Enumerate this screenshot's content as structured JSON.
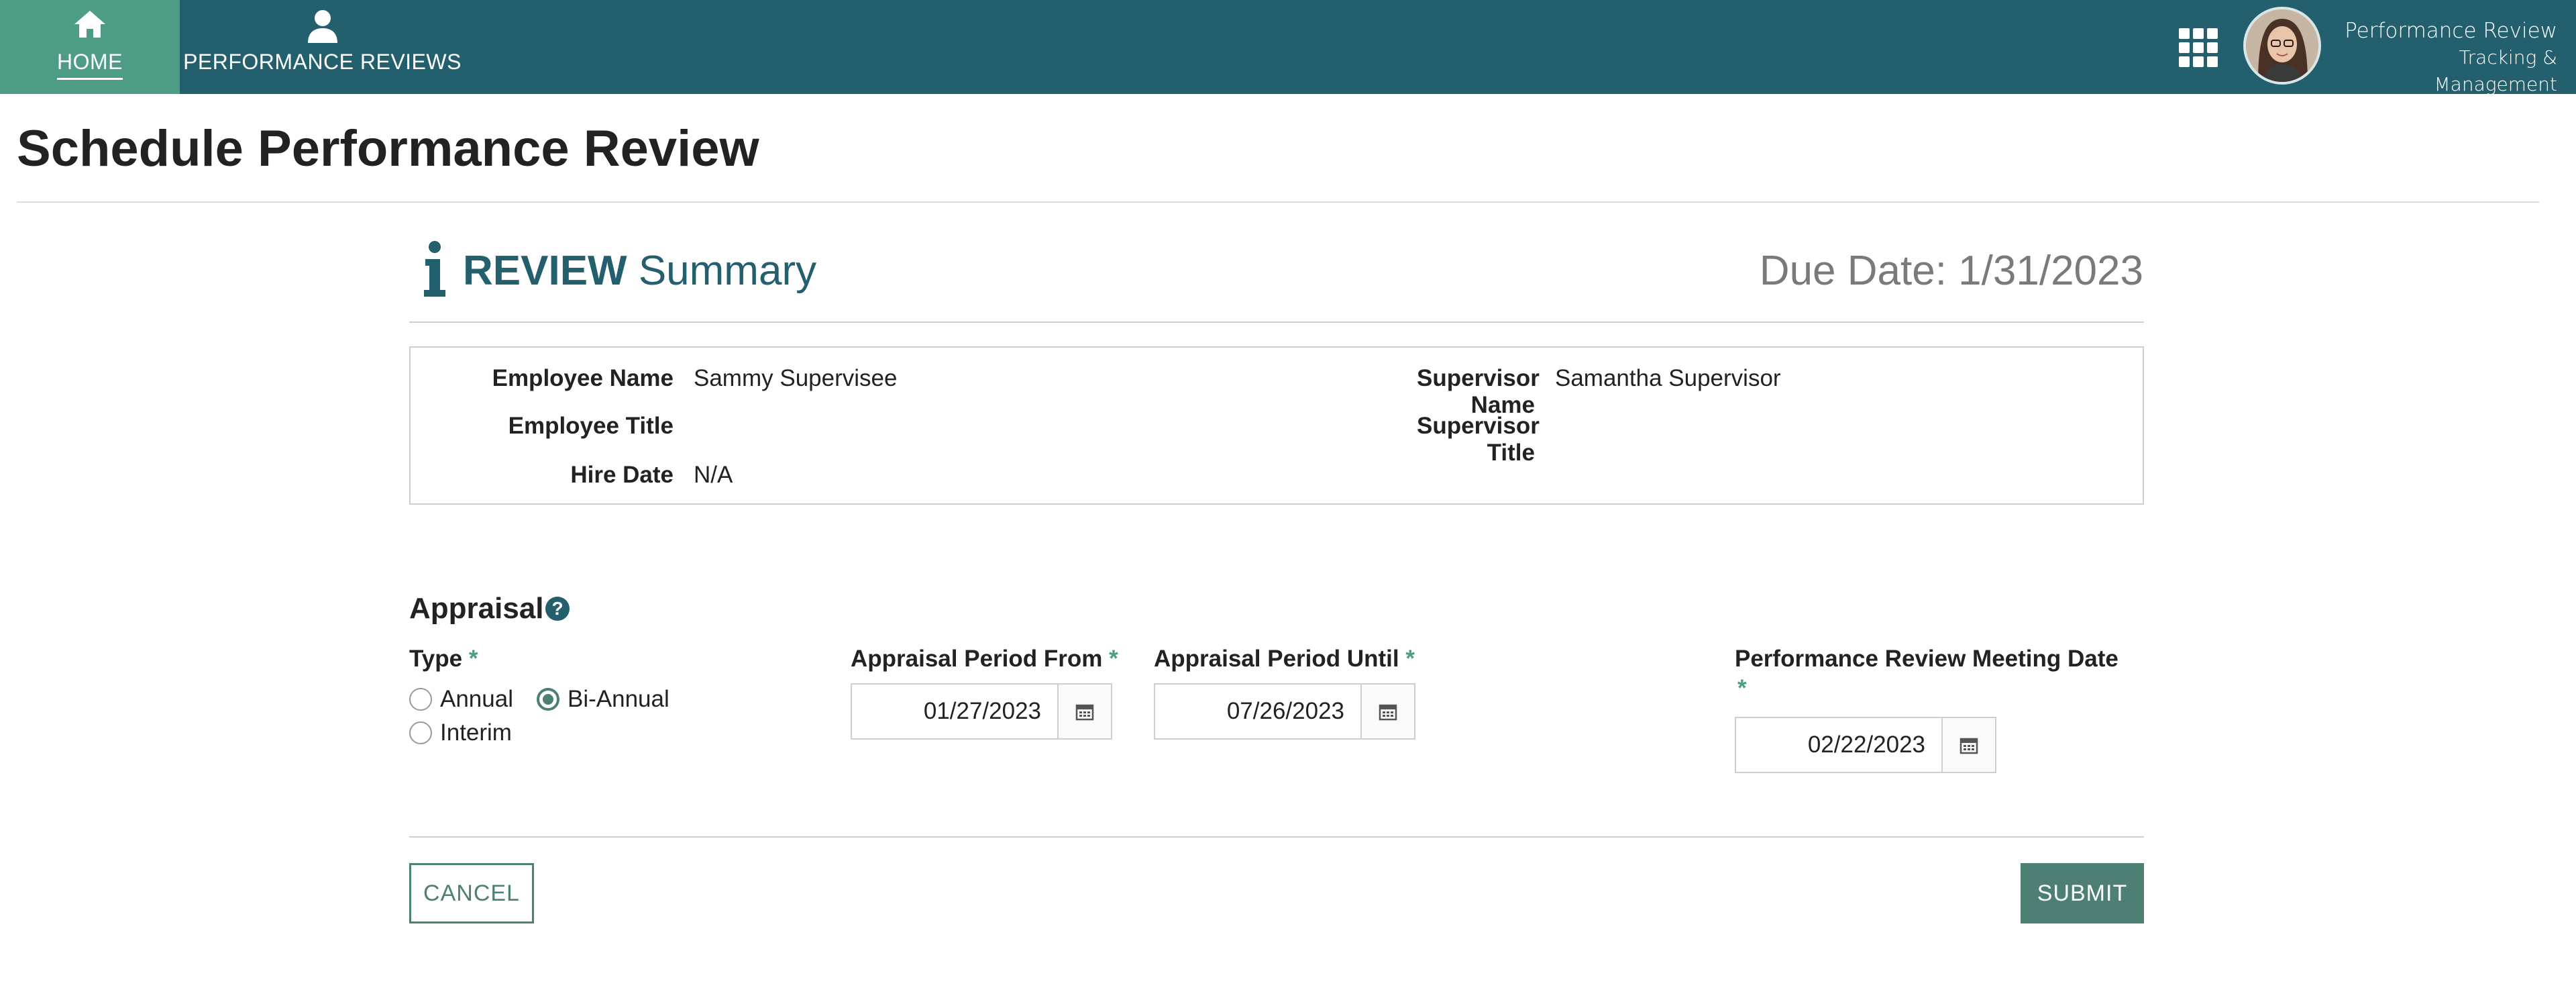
{
  "nav": {
    "home": {
      "label": "HOME",
      "icon": "home-icon"
    },
    "reviews": {
      "label": "PERFORMANCE REVIEWS",
      "icon": "user-icon"
    },
    "apps_icon": "grid-icon",
    "brand_line1": "Performance Review",
    "brand_line2": "Tracking & Management"
  },
  "page": {
    "title": "Schedule Performance Review"
  },
  "summary": {
    "heading_bold": "REVIEW",
    "heading_rest": "Summary",
    "due_date": "Due Date: 1/31/2023",
    "fields": {
      "employee_name_label": "Employee Name",
      "employee_name": "Sammy Supervisee",
      "employee_title_label": "Employee Title",
      "employee_title": "",
      "hire_date_label": "Hire Date",
      "hire_date": "N/A",
      "supervisor_name_label": "Supervisor Name",
      "supervisor_name": "Samantha Supervisor",
      "supervisor_title_label": "Supervisor Title",
      "supervisor_title": ""
    }
  },
  "appraisal": {
    "title": "Appraisal",
    "help_glyph": "?",
    "required_mark": "*",
    "type_label": "Type",
    "type_options": [
      {
        "label": "Annual",
        "selected": false
      },
      {
        "label": "Bi-Annual",
        "selected": true
      },
      {
        "label": "Interim",
        "selected": false
      }
    ],
    "period_from_label": "Appraisal Period From",
    "period_from_value": "01/27/2023",
    "period_until_label": "Appraisal Period Until",
    "period_until_value": "07/26/2023",
    "meeting_date_label": "Performance Review Meeting Date",
    "meeting_date_value": "02/22/2023"
  },
  "actions": {
    "cancel": "CANCEL",
    "submit": "SUBMIT"
  },
  "colors": {
    "nav_bg": "#245f6e",
    "nav_active": "#4d9d86",
    "accent": "#4d7f74",
    "heading": "#245f6e"
  }
}
